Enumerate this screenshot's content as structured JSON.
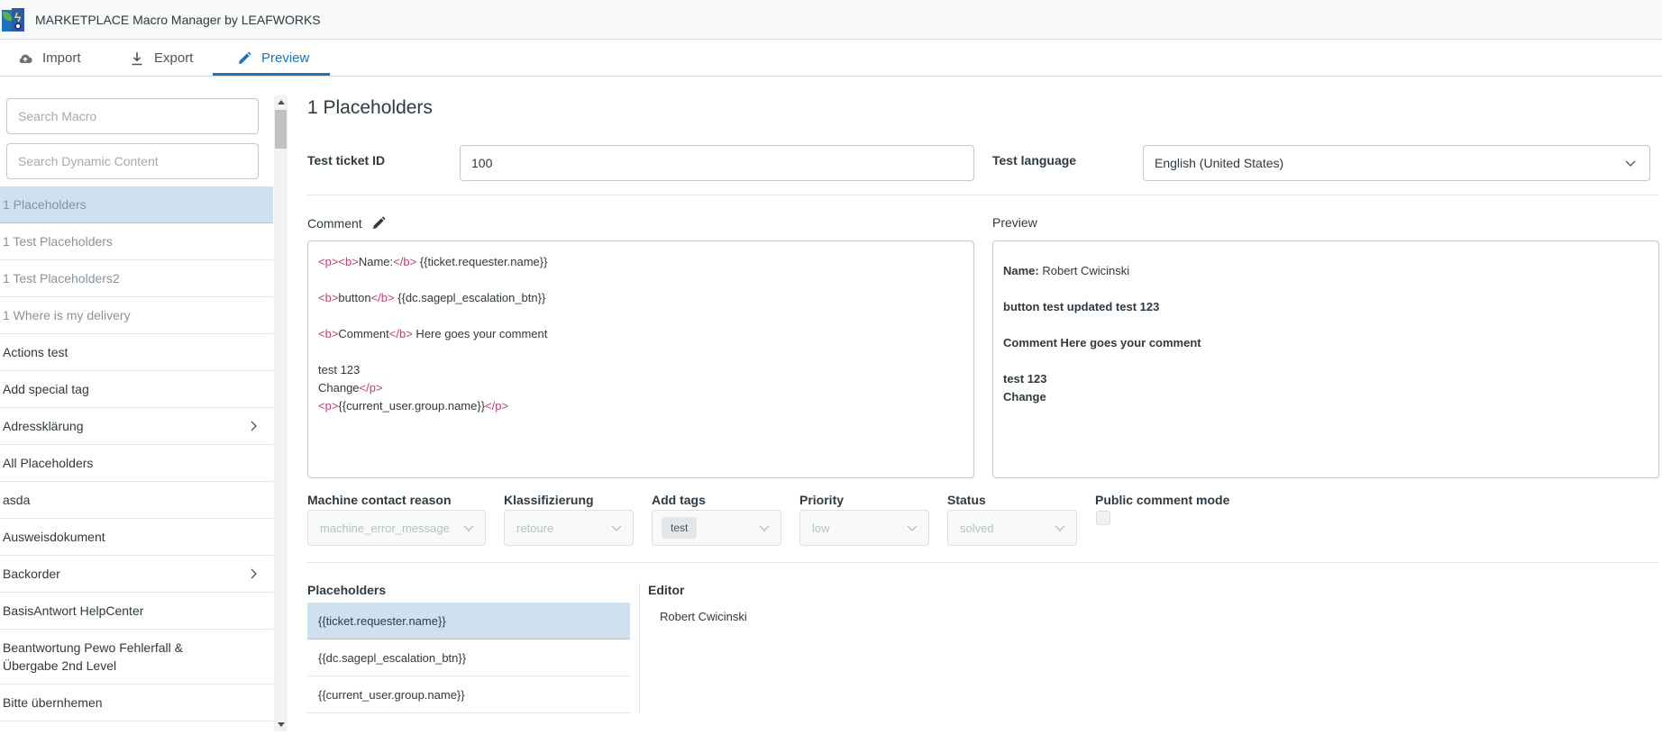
{
  "app": {
    "title": "MARKETPLACE Macro Manager by LEAFWORKS"
  },
  "tabs": [
    {
      "label": "Import",
      "icon": "cloud-upload-icon",
      "active": false
    },
    {
      "label": "Export",
      "icon": "download-icon",
      "active": false
    },
    {
      "label": "Preview",
      "icon": "pencil-icon",
      "active": true
    }
  ],
  "sidebar": {
    "search_macro_placeholder": "Search Macro",
    "search_dc_placeholder": "Search Dynamic Content",
    "items": [
      {
        "label": "1 Placeholders",
        "selected": true,
        "dim": true,
        "has_children": false
      },
      {
        "label": "1 Test Placeholders",
        "dim": true,
        "has_children": false
      },
      {
        "label": "1 Test Placeholders2",
        "dim": true,
        "has_children": false
      },
      {
        "label": "1 Where is my delivery",
        "dim": true,
        "has_children": false
      },
      {
        "label": "Actions test",
        "has_children": false
      },
      {
        "label": "Add special tag",
        "has_children": false
      },
      {
        "label": "Adressklärung",
        "has_children": true
      },
      {
        "label": "All Placeholders",
        "has_children": false
      },
      {
        "label": "asda",
        "has_children": false
      },
      {
        "label": "Ausweisdokument",
        "has_children": false
      },
      {
        "label": "Backorder",
        "has_children": true
      },
      {
        "label": "BasisAntwort HelpCenter",
        "has_children": false
      },
      {
        "label_line1": "Beantwortung Pewo Fehlerfall &",
        "label_line2": "Übergabe 2nd Level",
        "has_children": false
      },
      {
        "label": "Bitte übernhemen",
        "has_children": false
      }
    ]
  },
  "main": {
    "title": "1 Placeholders",
    "test_ticket_label": "Test ticket ID",
    "test_ticket_value": "100",
    "test_language_label": "Test language",
    "test_language_value": "English (United States)",
    "comment_label": "Comment",
    "preview_label": "Preview",
    "comment_code": {
      "line1": {
        "t1": "<p>",
        "t2": "<b>",
        "text": "Name:",
        "t3": "</b>",
        "rest": " {{ticket.requester.name}}"
      },
      "line2": {
        "t1": "<b>",
        "text": "button",
        "t2": "</b>",
        "rest": " {{dc.sagepl_escalation_btn}}"
      },
      "line3": {
        "t1": "<b>",
        "text": "Comment",
        "t2": "</b>",
        "rest": " Here goes your comment"
      },
      "line4": "test 123",
      "line5": {
        "text": "Change",
        "t1": "</p>"
      },
      "line6": {
        "t1": "<p>",
        "text": "{{current_user.group.name}}",
        "t2": "</p>"
      }
    },
    "preview": {
      "name_label": "Name:",
      "name_value": " Robert Cwicinski",
      "line2": "button test updated test 123",
      "line3": "Comment Here goes your comment",
      "line4": "test 123",
      "line5": "Change"
    },
    "properties": [
      {
        "label": "Machine contact reason",
        "value": "machine_error_message"
      },
      {
        "label": "Klassifizierung",
        "value": "retoure"
      },
      {
        "label": "Add tags",
        "value": "test"
      },
      {
        "label": "Priority",
        "value": "low"
      },
      {
        "label": "Status",
        "value": "solved"
      },
      {
        "label": "Public comment mode",
        "checked": false
      }
    ],
    "placeholders_label": "Placeholders",
    "editor_label": "Editor",
    "placeholders": [
      {
        "label": "{{ticket.requester.name}}",
        "selected": true
      },
      {
        "label": "{{dc.sagepl_escalation_btn}}",
        "selected": false
      },
      {
        "label": "{{current_user.group.name}}",
        "selected": false
      }
    ],
    "editor_value": "Robert Cwicinski"
  },
  "colors": {
    "accent": "#1f73b7",
    "selected_bg": "#cfe1ef",
    "tag_color": "#b0457a"
  }
}
